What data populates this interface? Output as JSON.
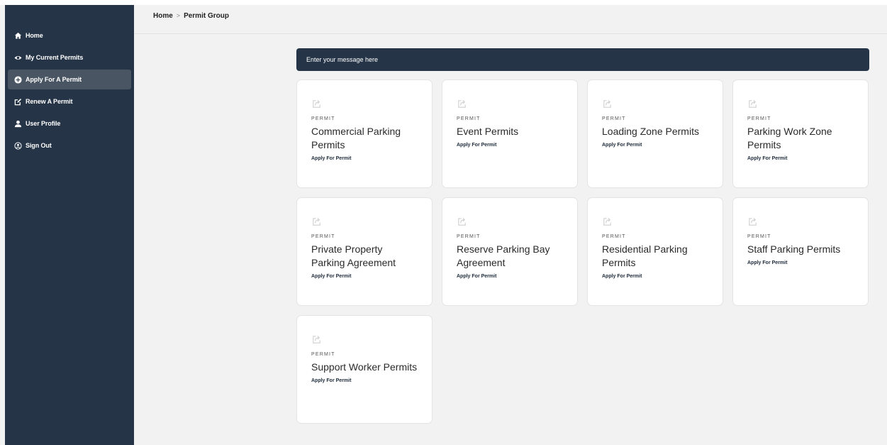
{
  "sidebar": {
    "items": [
      {
        "label": "Home",
        "icon": "home-icon",
        "active": false
      },
      {
        "label": "My Current Permits",
        "icon": "eye-icon",
        "active": false
      },
      {
        "label": "Apply For A Permit",
        "icon": "plus-circle-icon",
        "active": true
      },
      {
        "label": "Renew A Permit",
        "icon": "edit-icon",
        "active": false
      },
      {
        "label": "User Profile",
        "icon": "user-icon",
        "active": false
      },
      {
        "label": "Sign Out",
        "icon": "sign-out-icon",
        "active": false
      }
    ]
  },
  "breadcrumb": {
    "home": "Home",
    "separator": ">",
    "current": "Permit Group"
  },
  "banner": {
    "message": "Enter your message here"
  },
  "cards": [
    {
      "tag": "PERMIT",
      "title": "Commercial Parking Permits",
      "link": "Apply For Permit",
      "icon": "external-link-icon"
    },
    {
      "tag": "PERMIT",
      "title": "Event Permits",
      "link": "Apply For Permit",
      "icon": "external-link-icon"
    },
    {
      "tag": "PERMIT",
      "title": "Loading Zone Permits",
      "link": "Apply For Permit",
      "icon": "external-link-icon"
    },
    {
      "tag": "PERMIT",
      "title": "Parking Work Zone Permits",
      "link": "Apply For Permit",
      "icon": "external-link-icon"
    },
    {
      "tag": "PERMIT",
      "title": "Private Property Parking Agreement",
      "link": "Apply For Permit",
      "icon": "external-link-icon"
    },
    {
      "tag": "PERMIT",
      "title": "Reserve Parking Bay Agreement",
      "link": "Apply For Permit",
      "icon": "external-link-icon"
    },
    {
      "tag": "PERMIT",
      "title": "Residential Parking Permits",
      "link": "Apply For Permit",
      "icon": "external-link-icon"
    },
    {
      "tag": "PERMIT",
      "title": "Staff Parking Permits",
      "link": "Apply For Permit",
      "icon": "external-link-icon"
    },
    {
      "tag": "PERMIT",
      "title": "Support Worker Permits",
      "link": "Apply For Permit",
      "icon": "external-link-icon"
    }
  ],
  "colors": {
    "sidebar_bg": "#253447",
    "active_item": "#4a5563",
    "banner_bg": "#253447",
    "page_bg": "#f2f2f2",
    "card_bg": "#ffffff"
  }
}
